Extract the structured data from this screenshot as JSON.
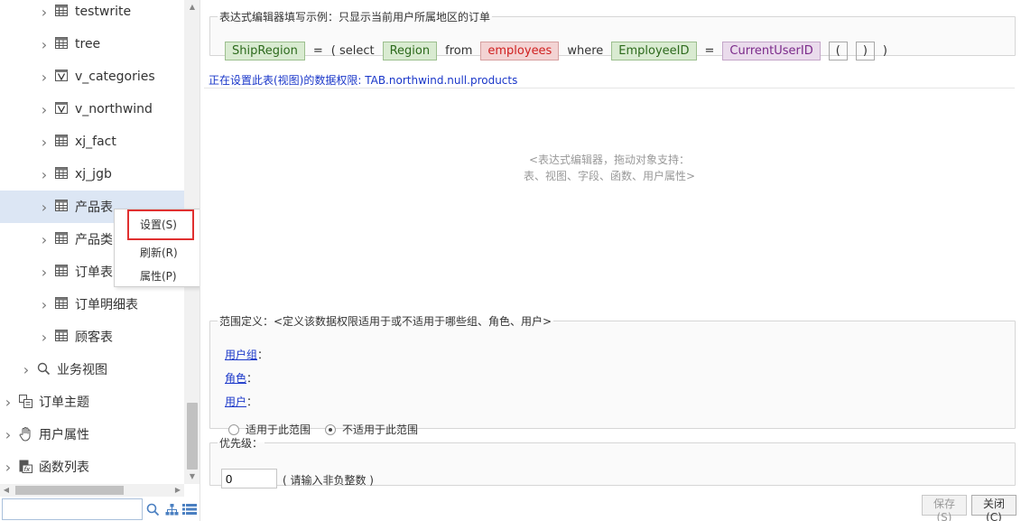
{
  "tree": {
    "items": [
      {
        "label": "testwrite",
        "icon": "table-icon",
        "level": 2
      },
      {
        "label": "tree",
        "icon": "table-icon",
        "level": 2
      },
      {
        "label": "v_categories",
        "icon": "view-icon",
        "level": 2
      },
      {
        "label": "v_northwind",
        "icon": "view-icon",
        "level": 2
      },
      {
        "label": "xj_fact",
        "icon": "table-icon",
        "level": 2
      },
      {
        "label": "xj_jgb",
        "icon": "table-icon",
        "level": 2
      },
      {
        "label": "产品表",
        "icon": "table-icon",
        "level": 2,
        "selected": true
      },
      {
        "label": "产品类",
        "icon": "table-icon",
        "level": 2
      },
      {
        "label": "订单表",
        "icon": "table-icon",
        "level": 2
      },
      {
        "label": "订单明细表",
        "icon": "table-icon",
        "level": 2
      },
      {
        "label": "顾客表",
        "icon": "table-icon",
        "level": 2
      },
      {
        "label": "业务视图",
        "icon": "search-icon",
        "level": 1
      },
      {
        "label": "订单主题",
        "icon": "topic-icon",
        "level": 0
      },
      {
        "label": "用户属性",
        "icon": "hand-icon",
        "level": 0
      },
      {
        "label": "函数列表",
        "icon": "function-icon",
        "level": 0
      }
    ],
    "search_value": ""
  },
  "context_menu": {
    "items": [
      {
        "label": "设置(S)"
      },
      {
        "label": "刷新(R)"
      },
      {
        "label": "属性(P)"
      }
    ]
  },
  "example": {
    "legend": "表达式编辑器填写示例：只显示当前用户所属地区的订单",
    "tokens": [
      {
        "text": "ShipRegion",
        "kind": "green"
      },
      {
        "text": "=",
        "kind": "kw"
      },
      {
        "text": "( select",
        "kind": "kw"
      },
      {
        "text": "Region",
        "kind": "green"
      },
      {
        "text": "from",
        "kind": "kw"
      },
      {
        "text": "employees",
        "kind": "red"
      },
      {
        "text": "where",
        "kind": "kw"
      },
      {
        "text": "EmployeeID",
        "kind": "green"
      },
      {
        "text": "=",
        "kind": "kw"
      },
      {
        "text": "CurrentUserID",
        "kind": "purple"
      },
      {
        "text": "(",
        "kind": "plain"
      },
      {
        "text": ")",
        "kind": "plain"
      },
      {
        "text": ")",
        "kind": "kw"
      }
    ]
  },
  "permission": {
    "title": "正在设置此表(视图)的数据权限: TAB.northwind.null.products",
    "editor_hint_line1": "<表达式编辑器，拖动对象支持：",
    "editor_hint_line2": "表、视图、字段、函数、用户属性>"
  },
  "scope": {
    "legend": "范围定义：<定义该数据权限适用于或不适用于哪些组、角色、用户>",
    "user_group_label": "用户组",
    "role_label": "角色",
    "user_label": "用户",
    "colon": "：",
    "radio_apply": "适用于此范围",
    "radio_not_apply": "不适用于此范围",
    "selected": "not_apply"
  },
  "priority": {
    "legend": "优先级：",
    "value": "0",
    "hint": "( 请输入非负整数 )"
  },
  "buttons": {
    "save": "保存(S)",
    "close": "关闭(C)"
  },
  "colors": {
    "selected_row": "#dce6f4",
    "link": "#1a37c9",
    "highlight_border": "#e03030"
  }
}
